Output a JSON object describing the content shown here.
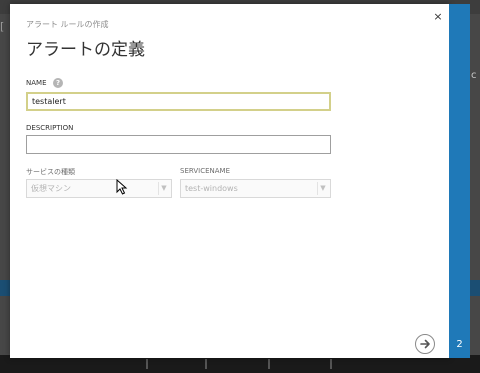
{
  "background": {
    "left_fragment": "[",
    "right_fragment": "c"
  },
  "dialog": {
    "subtitle": "アラート ルールの作成",
    "title": "アラートの定義",
    "close_glyph": "×",
    "step_number": "2"
  },
  "form": {
    "name": {
      "label": "NAME",
      "value": "testalert",
      "help_glyph": "?"
    },
    "description": {
      "label": "DESCRIPTION",
      "value": ""
    },
    "service_type": {
      "label": "サービスの種類",
      "selected": "仮想マシン"
    },
    "service_name": {
      "label": "SERVICENAME",
      "selected": "test-windows"
    }
  },
  "icons": {
    "close": "close-icon",
    "help": "help-icon",
    "next": "arrow-right-icon",
    "cursor": "mouse-pointer-icon",
    "chevron": "chevron-down-icon"
  },
  "colors": {
    "accent_panel": "#1f79b8",
    "focus_border": "#d3d08a",
    "portal_bar": "#1b4e73"
  }
}
